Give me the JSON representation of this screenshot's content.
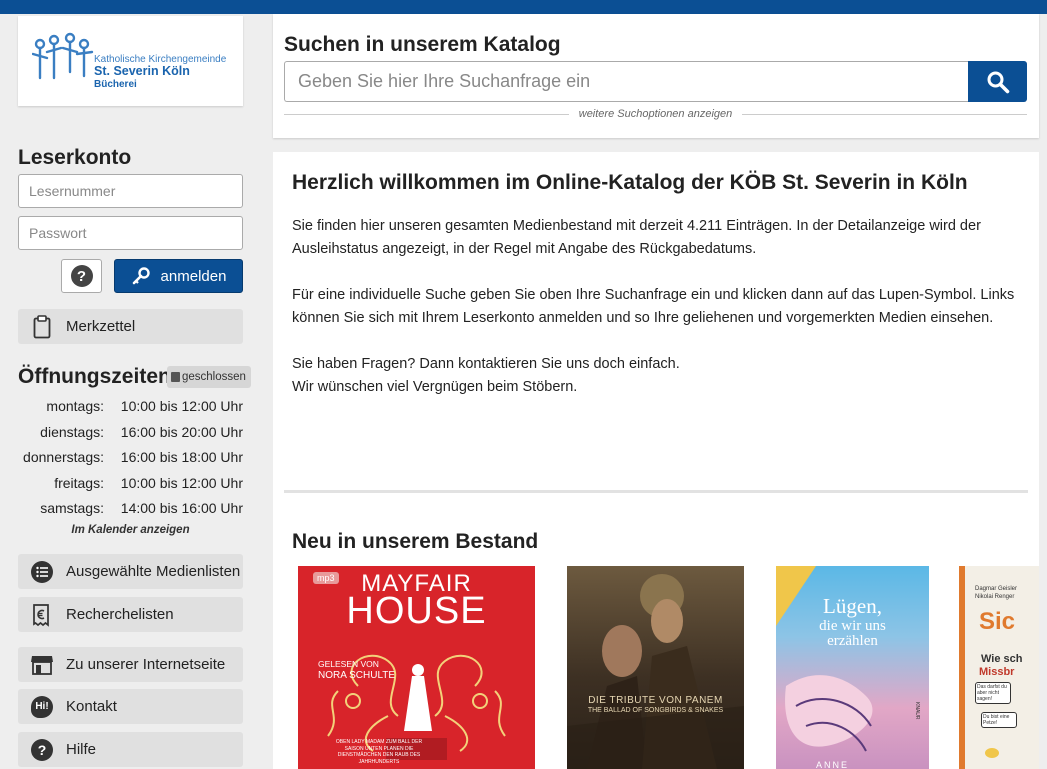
{
  "logo": {
    "line1": "Katholische Kirchengemeinde",
    "line2": "St. Severin Köln",
    "line3": "Bücherei"
  },
  "account": {
    "heading": "Leserkonto",
    "reader_number_placeholder": "Lesernummer",
    "password_placeholder": "Passwort",
    "help_label": "?",
    "login_label": "anmelden"
  },
  "sidebar": {
    "notepad_label": "Merkzettel",
    "links": [
      {
        "label": "Ausgewählte Medienlisten",
        "icon": "list-icon"
      },
      {
        "label": "Recherchelisten",
        "icon": "euro-receipt-icon"
      },
      {
        "label": "Zu unserer Internetseite",
        "icon": "shop-icon"
      },
      {
        "label": "Kontakt",
        "icon": "chat-hi-icon"
      },
      {
        "label": "Hilfe",
        "icon": "help-icon"
      }
    ],
    "kontakt_badge": "Hi!",
    "help_glyph": "?"
  },
  "opening_hours": {
    "heading": "Öffnungszeiten",
    "status_badge": "geschlossen",
    "rows": [
      {
        "day": "montags:",
        "time": "10:00 bis 12:00 Uhr"
      },
      {
        "day": "dienstags:",
        "time": "16:00 bis 20:00 Uhr"
      },
      {
        "day": "donnerstags:",
        "time": "16:00 bis 18:00 Uhr"
      },
      {
        "day": "freitags:",
        "time": "10:00 bis 12:00 Uhr"
      },
      {
        "day": "samstags:",
        "time": "14:00 bis 16:00 Uhr"
      }
    ],
    "calendar_link": "Im Kalender anzeigen"
  },
  "search": {
    "title": "Suchen in unserem Katalog",
    "placeholder": "Geben Sie hier Ihre Suchanfrage ein",
    "more_options": "weitere Suchoptionen anzeigen"
  },
  "main": {
    "title": "Herzlich willkommen im Online-Katalog der KÖB St. Severin in Köln",
    "paragraphs": [
      "Sie finden hier unseren gesamten Medienbestand mit derzeit 4.211 Einträgen. In der Detailanzeige wird der Ausleihstatus angezeigt, in der Regel mit Angabe des Rückgabedatums.",
      "Für eine individuelle Suche geben Sie oben Ihre Suchanfrage ein und klicken dann auf das Lupen-Symbol. Links können Sie sich mit Ihrem Leserkonto anmelden und so Ihre geliehenen und vorgemerkten Medien einsehen.",
      "Sie haben Fragen? Dann kontaktieren Sie uns doch einfach.\nWir wünschen viel Vergnügen beim Stöbern."
    ],
    "new_heading": "Neu in unserem Bestand"
  },
  "covers": [
    {
      "badge": "mp3",
      "title1": "MAYFAIR",
      "title2": "HOUSE",
      "reader1": "GELESEN VON",
      "reader2": "NORA SCHULTE",
      "tagline": "OBEN LADY MADAM ZUM BALL DER SAISON UNTEN PLANEN DIE DIENSTMÄDCHEN DEN RAUB DES JAHRHUNDERTS"
    },
    {
      "title1": "DIE TRIBUTE VON PANEM",
      "title2": "THE BALLAD OF SONGBIRDS & SNAKES"
    },
    {
      "title1": "Lügen,",
      "title2": "die wir uns",
      "title3": "erzählen",
      "publisher": "KNAUR",
      "author": "ANNE"
    },
    {
      "author1": "Dagmar Geisler",
      "author2": "Nikolai Renger",
      "title1": "Sic",
      "title2": "Wie sch",
      "title3": "Missbr",
      "bubble1": "Das darfst du aber nicht sagen!",
      "bubble2": "Du bist eine Petze!"
    }
  ],
  "colors": {
    "brand_blue": "#0b4f94",
    "cover1_red": "#d8242a"
  }
}
